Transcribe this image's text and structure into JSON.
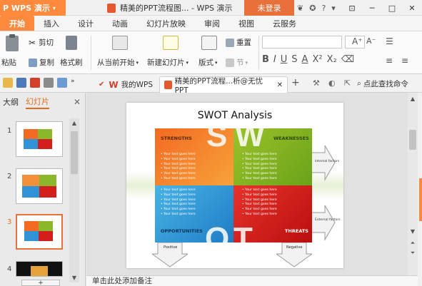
{
  "app": {
    "name": "WPS 演示",
    "caret": "▾"
  },
  "window": {
    "title": "精美的PPT流程图... - WPS 演示",
    "login": "未登录",
    "help": "?",
    "minimize": "─",
    "maximize": "□",
    "close": "✕"
  },
  "menu": {
    "tabs": [
      "开始",
      "插入",
      "设计",
      "动画",
      "幻灯片放映",
      "审阅",
      "视图",
      "云服务"
    ],
    "active": "开始"
  },
  "ribbon": {
    "cut": "剪切",
    "paste": "粘贴",
    "copy": "复制",
    "format_painter": "格式刷",
    "from_start": "从当前开始",
    "new_slide": "新建幻灯片",
    "layout": "版式",
    "reset": "重置",
    "section": "节"
  },
  "tabs": {
    "home": "我的WPS",
    "doc": "精美的PPT流程...析@无忧PPT",
    "search": "点此查找命令"
  },
  "left_panel": {
    "outline_tab": "大纲",
    "slides_tab": "幻灯片",
    "slide_numbers": [
      "1",
      "2",
      "3",
      "4"
    ],
    "active_slide": 3
  },
  "slide": {
    "title": "SWOT Analysis",
    "strengths": "STRENGTHS",
    "weaknesses": "WEAKNESSES",
    "opportunities": "OPPORTUNITIES",
    "threats": "THREATS",
    "letter_s": "S",
    "letter_w": "W",
    "letter_o": "O",
    "letter_t": "T",
    "bullet_text": "Your text goes here",
    "internal_factors": "Internal factors",
    "external_factors": "External factors",
    "positive": "Positive",
    "negative": "Negative"
  },
  "notes": {
    "placeholder": "单击此处添加备注"
  },
  "colors": {
    "accent": "#ff8a3d",
    "strengths": "#f36a22",
    "weaknesses": "#8ab82a",
    "opportunities": "#2f93d6",
    "threats": "#d41d1d"
  }
}
